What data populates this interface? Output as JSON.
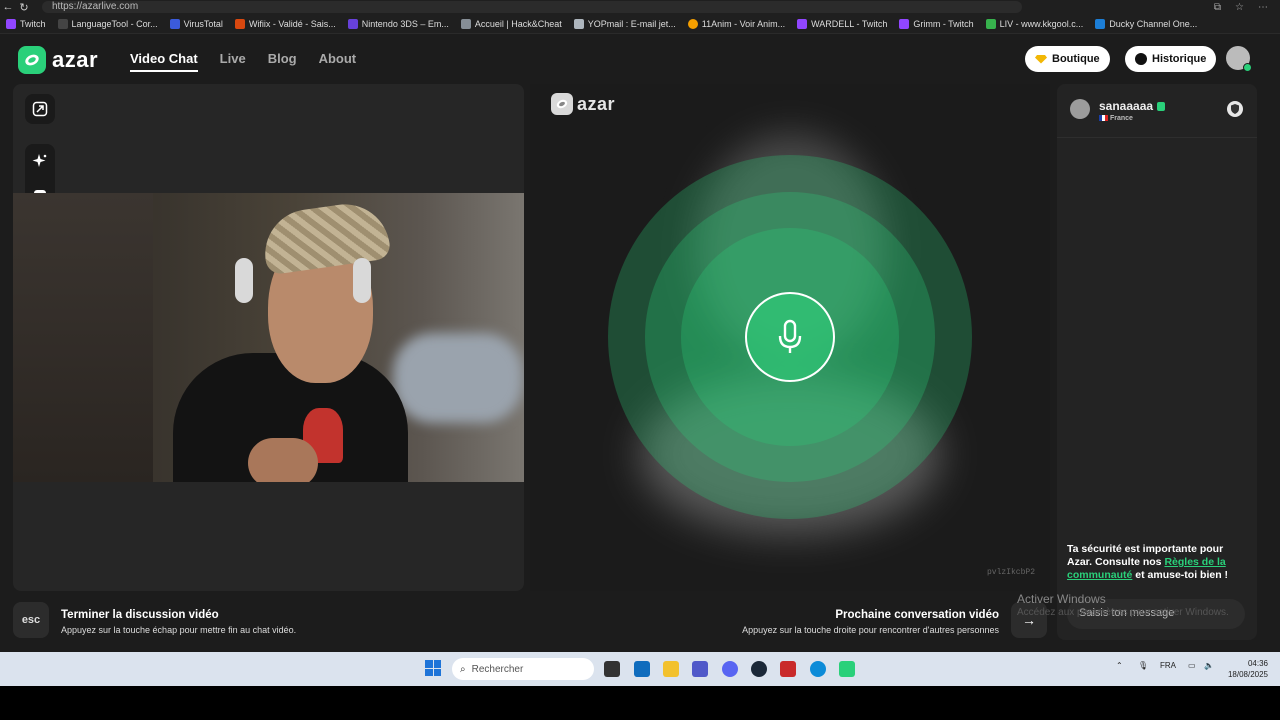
{
  "browser": {
    "url": "https://azarlive.com",
    "bookmarks": [
      "Twitch",
      "LanguageTool - Cor...",
      "VirusTotal",
      "Wifiix - Validé - Sais...",
      "Nintendo 3DS – Em...",
      "Accueil | Hack&Cheat",
      "YOPmail : E-mail jet...",
      "11Anim - Voir Anim...",
      "WARDELL - Twitch",
      "Grimm - Twitch",
      "LIV - www.kkgool.c...",
      "Ducky Channel One..."
    ]
  },
  "header": {
    "logo": "azar",
    "nav": [
      "Video Chat",
      "Live",
      "Blog",
      "About"
    ],
    "boutique_label": "Boutique",
    "historique_label": "Historique"
  },
  "center": {
    "logo": "azar",
    "room_code": "pvlzIkcbP2"
  },
  "chat": {
    "partner_name": "sanaaaaa",
    "partner_country": "France",
    "safety_text_1": "Ta sécurité est importante pour Azar. Consulte nos ",
    "safety_link": "Règles de la communauté",
    "safety_text_2": " et amuse-toi bien !",
    "input_placeholder": "Saisis ton message"
  },
  "watermark": {
    "title": "Activer Windows",
    "subtitle": "Accédez aux paramètres pour activer Windows."
  },
  "footer": {
    "esc_key": "esc",
    "end_title": "Terminer la discussion vidéo",
    "end_sub": "Appuyez sur la touche échap pour mettre fin au chat vidéo.",
    "next_title": "Prochaine conversation vidéo",
    "next_sub": "Appuyez sur la touche droite pour rencontrer d'autres personnes",
    "next_arrow": "→"
  },
  "taskbar": {
    "search_placeholder": "Rechercher",
    "language": "FRA",
    "time": "04:36",
    "date": "18/08/2025"
  },
  "colors": {
    "accent": "#2ad07a",
    "background": "#1c1c1c"
  }
}
